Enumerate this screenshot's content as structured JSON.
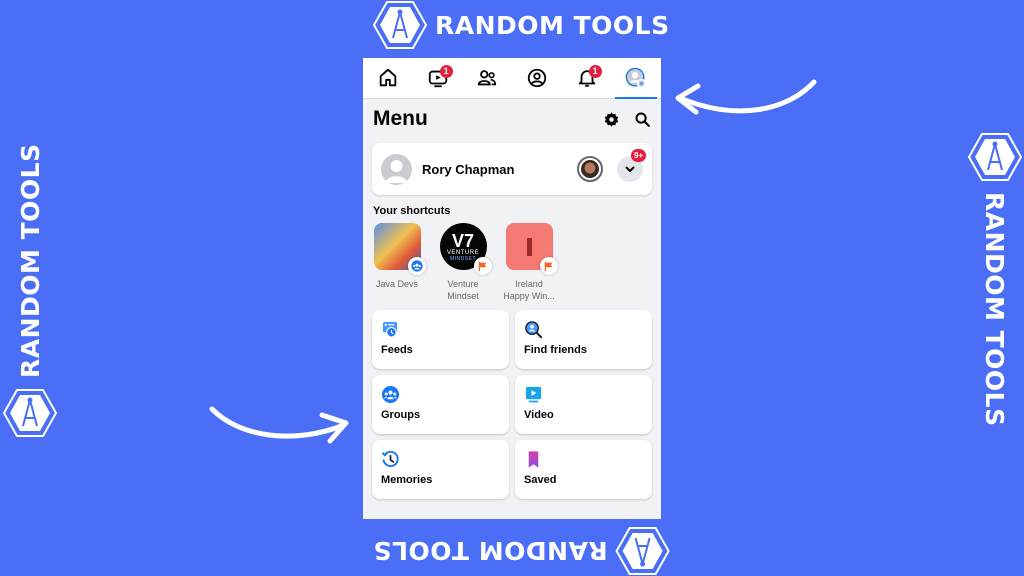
{
  "brand": {
    "name": "RANDOM TOOLS",
    "logo_icon": "compass-hexagon-icon"
  },
  "colors": {
    "background": "#4a6ef5",
    "accent": "#1877f2",
    "badge": "#e41e3f"
  },
  "topnav": {
    "items": [
      {
        "name": "home",
        "icon": "home-icon",
        "badge": null,
        "active": false
      },
      {
        "name": "video",
        "icon": "video-icon",
        "badge": "1",
        "active": false
      },
      {
        "name": "friends",
        "icon": "friends-icon",
        "badge": null,
        "active": false
      },
      {
        "name": "profile",
        "icon": "profile-icon",
        "badge": null,
        "active": false
      },
      {
        "name": "notifications",
        "icon": "bell-icon",
        "badge": "1",
        "active": false
      },
      {
        "name": "menu",
        "icon": "menu-avatar-icon",
        "badge": null,
        "active": true
      }
    ]
  },
  "menu": {
    "title": "Menu",
    "settings_icon": "gear-icon",
    "search_icon": "search-icon"
  },
  "profile": {
    "name": "Rory Chapman",
    "switch_icon": "switch-account-icon",
    "more_badge": "9+"
  },
  "shortcuts": {
    "label": "Your shortcuts",
    "items": [
      {
        "name": "Java Devs",
        "type": "group"
      },
      {
        "name": "Venture\nMindset",
        "type": "page",
        "logo_top": "V7",
        "logo_text": "VENTURE",
        "logo_sub": "MINDSET"
      },
      {
        "name": "Ireland\nHappy Win...",
        "type": "page"
      }
    ]
  },
  "tiles": [
    {
      "label": "Feeds",
      "icon": "feeds-icon"
    },
    {
      "label": "Find friends",
      "icon": "find-friends-icon"
    },
    {
      "label": "Groups",
      "icon": "groups-icon"
    },
    {
      "label": "Video",
      "icon": "video-tile-icon"
    },
    {
      "label": "Memories",
      "icon": "memories-icon"
    },
    {
      "label": "Saved",
      "icon": "saved-icon"
    }
  ]
}
